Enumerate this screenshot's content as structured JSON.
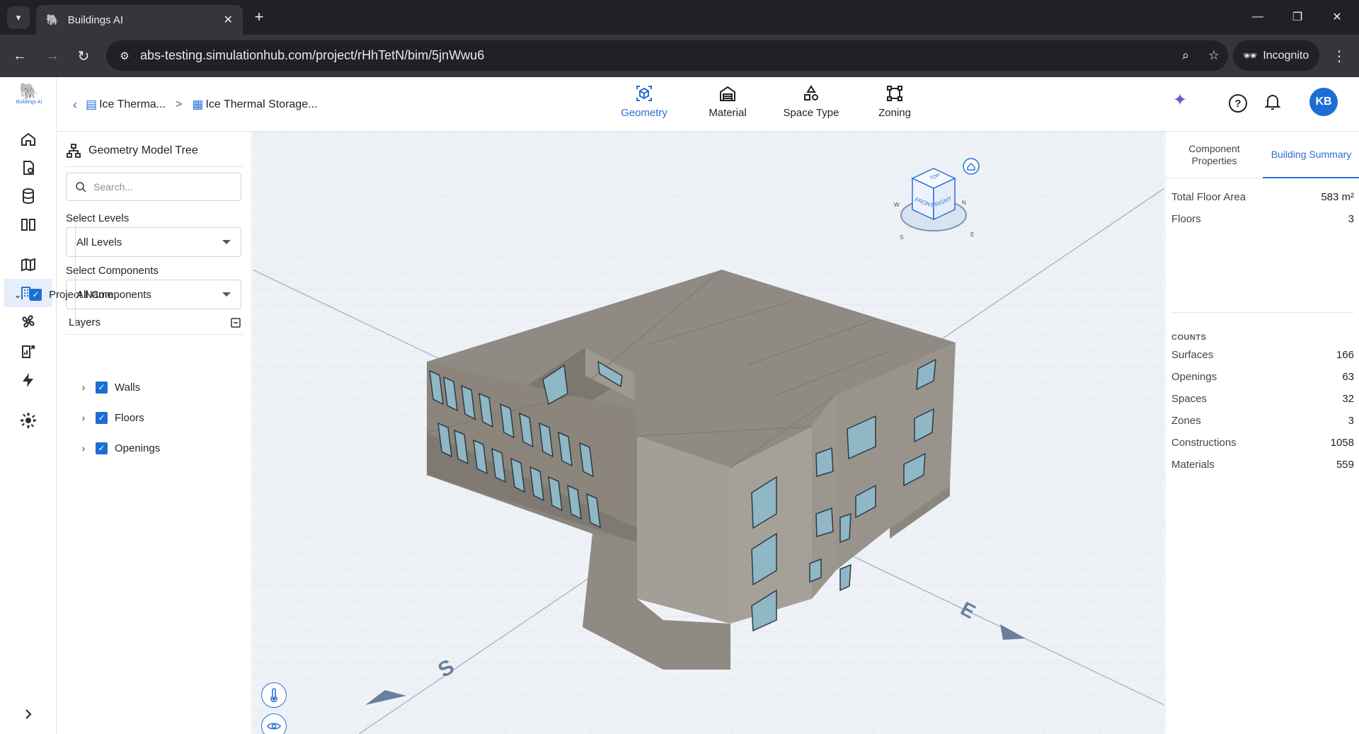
{
  "browser": {
    "tab_title": "Buildings AI",
    "url": "abs-testing.simulationhub.com/project/rHhTetN/bim/5jnWwu6",
    "incognito_label": "Incognito"
  },
  "app": {
    "logo_text": "Buildings AI",
    "breadcrumb": {
      "project": "Ice Therma...",
      "separator": ">",
      "model": "Ice Thermal Storage..."
    },
    "modes": [
      {
        "label": "Geometry",
        "icon": "geometry-icon",
        "active": true
      },
      {
        "label": "Material",
        "icon": "material-icon",
        "active": false
      },
      {
        "label": "Space Type",
        "icon": "space-type-icon",
        "active": false
      },
      {
        "label": "Zoning",
        "icon": "zoning-icon",
        "active": false
      }
    ],
    "avatar_initials": "KB"
  },
  "left_panel": {
    "title": "Geometry Model Tree",
    "search_placeholder": "Search...",
    "levels_label": "Select Levels",
    "levels_value": "All Levels",
    "components_label": "Select Components",
    "components_value": "All Components",
    "layers_label": "Layers",
    "tree": {
      "root": "Project Name",
      "children": [
        "Walls",
        "Floors",
        "Openings"
      ]
    }
  },
  "viewport": {
    "compass": {
      "n": "N",
      "s": "S",
      "e": "E",
      "w": "W"
    },
    "cube_faces": {
      "top": "TOP",
      "front": "FRONT",
      "right": "RIGHT"
    },
    "axis_labels": {
      "s": "S",
      "e": "E"
    }
  },
  "right_panel": {
    "tabs": [
      {
        "label": "Component Properties",
        "active": false
      },
      {
        "label": "Building Summary",
        "active": true
      }
    ],
    "summary": [
      {
        "label": "Total Floor Area",
        "value": "583 m²"
      },
      {
        "label": "Floors",
        "value": "3"
      }
    ],
    "counts_title": "COUNTS",
    "counts": [
      {
        "label": "Surfaces",
        "value": "166"
      },
      {
        "label": "Openings",
        "value": "63"
      },
      {
        "label": "Spaces",
        "value": "32"
      },
      {
        "label": "Zones",
        "value": "3"
      },
      {
        "label": "Constructions",
        "value": "1058"
      },
      {
        "label": "Materials",
        "value": "559"
      }
    ]
  },
  "colors": {
    "accent": "#2b6fd6",
    "building": "#8f8a82",
    "viewport_bg": "#eef2f7"
  }
}
